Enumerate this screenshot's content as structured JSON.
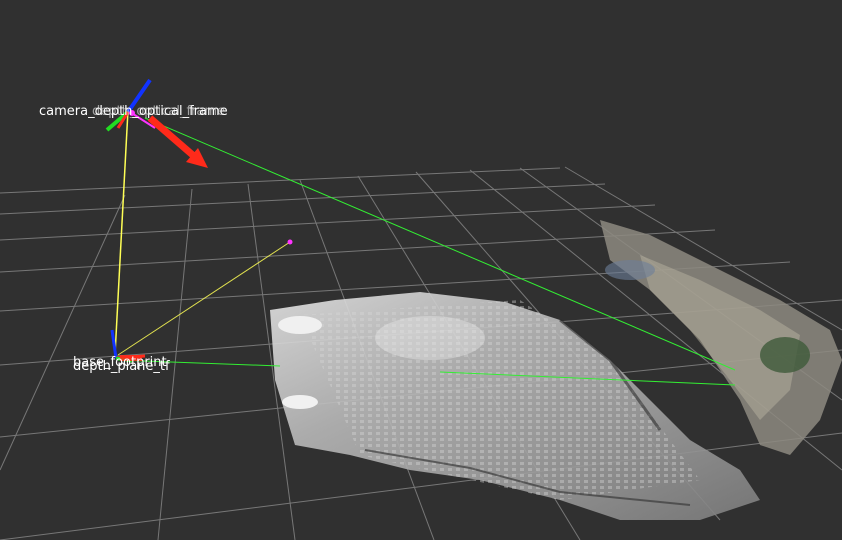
{
  "frames": {
    "camera_frame_top": "camera_depth_optical_frame",
    "camera_frame_overlap": "depth_optical_frame",
    "base_frame": "base_footprint",
    "depth_plane_frame": "depth_plane_tf"
  },
  "colors": {
    "background": "#303030",
    "grid": "#9a9a9a",
    "axis_x": "#ff2a1a",
    "axis_y": "#22dd22",
    "axis_z": "#1133ff",
    "tf_link_yellow": "#ffff55",
    "tf_link_green": "#33ee33",
    "marker_magenta": "#ff33ff",
    "pointcloud_gray": "#c8c8c8"
  }
}
